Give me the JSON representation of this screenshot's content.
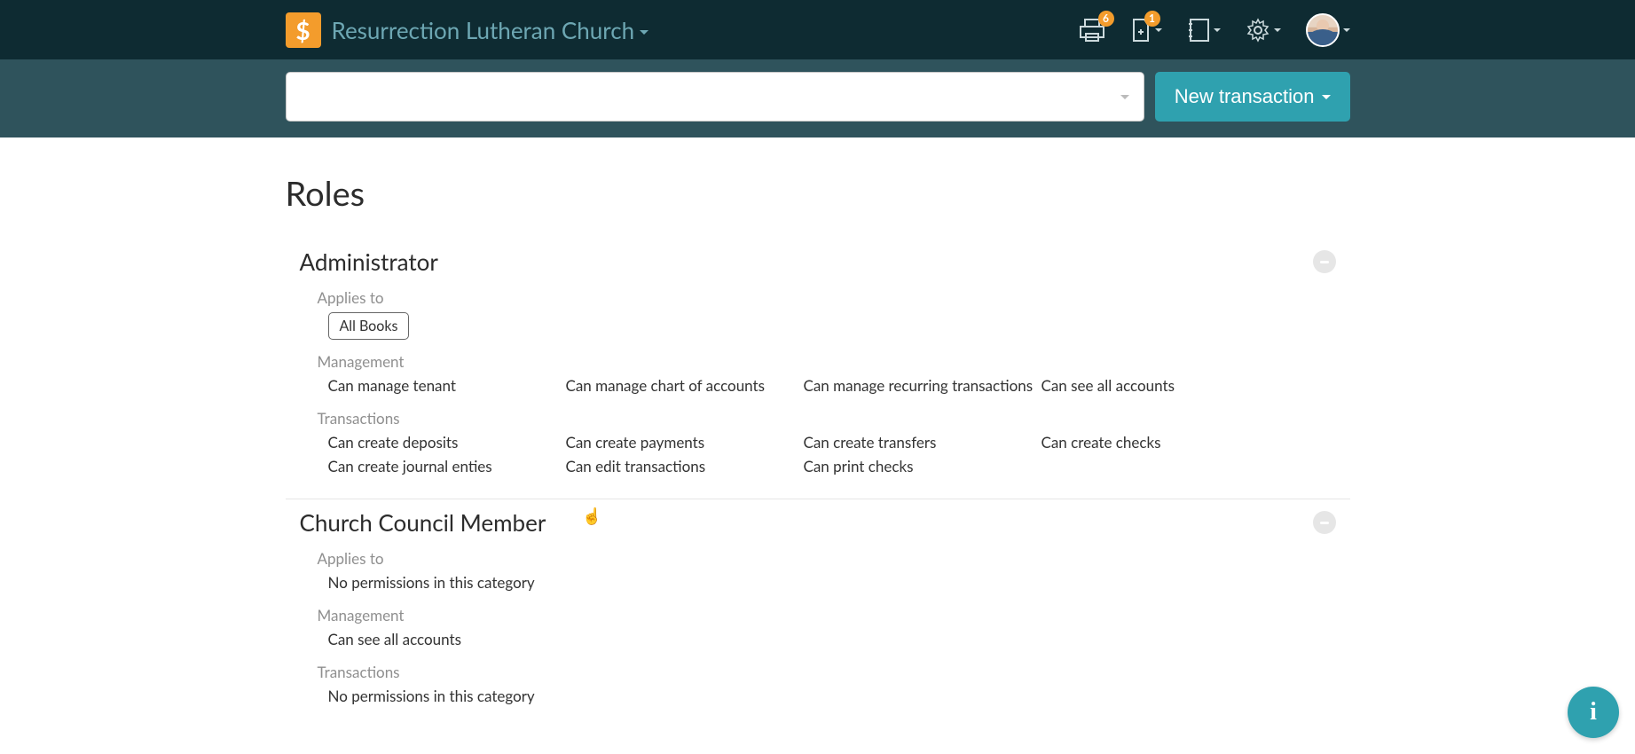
{
  "brand": {
    "logo_symbol": "$",
    "title": "Resurrection Lutheran Church"
  },
  "nav": {
    "print_badge": "6",
    "new_doc_badge": "1"
  },
  "subbar": {
    "new_transaction_label": "New transaction"
  },
  "page": {
    "title": "Roles"
  },
  "roles": [
    {
      "title": "Administrator",
      "applies_to_label": "Applies to",
      "applies_to_pill": "All Books",
      "management_label": "Management",
      "management_perms": [
        "Can manage tenant",
        "Can manage chart of accounts",
        "Can manage recurring transactions",
        "Can see all accounts"
      ],
      "transactions_label": "Transactions",
      "transactions_perms": [
        "Can create deposits",
        "Can create payments",
        "Can create transfers",
        "Can create checks",
        "Can create journal enties",
        "Can edit transactions",
        "Can print checks"
      ]
    },
    {
      "title": "Church Council Member",
      "applies_to_label": "Applies to",
      "applies_to_empty": "No permissions in this category",
      "management_label": "Management",
      "management_perms": [
        "Can see all accounts"
      ],
      "transactions_label": "Transactions",
      "transactions_empty": "No permissions in this category"
    }
  ],
  "info_fab": "i"
}
